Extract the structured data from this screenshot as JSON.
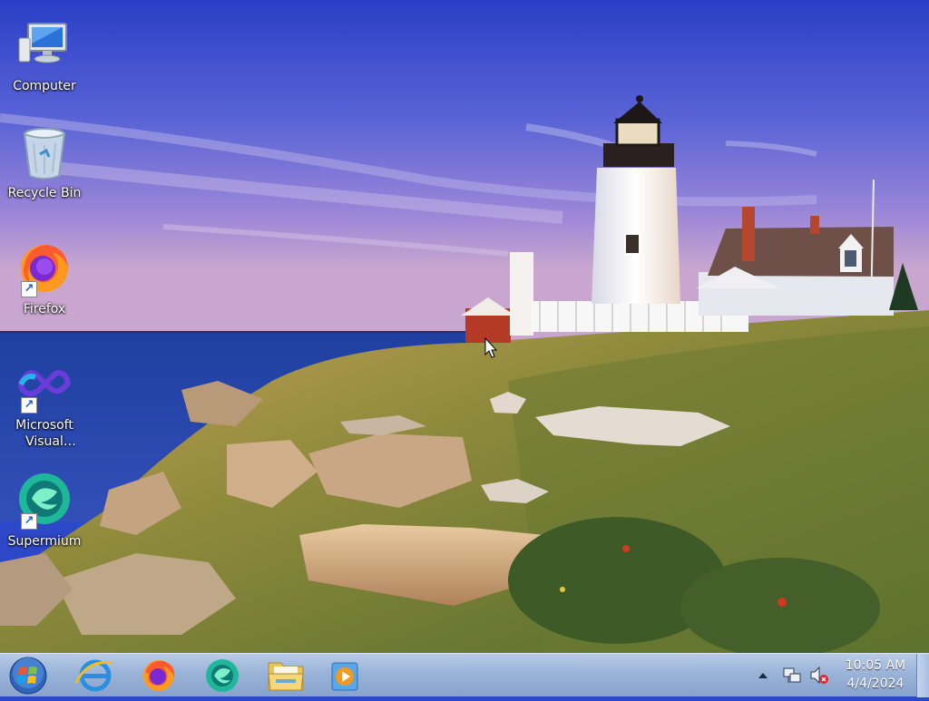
{
  "desktop": {
    "icons": [
      {
        "label": "Computer",
        "icon": "computer-icon"
      },
      {
        "label": "Recycle Bin",
        "icon": "recycle-bin-icon"
      },
      {
        "label": "Firefox",
        "icon": "firefox-icon"
      },
      {
        "label": "Microsoft Visual Studi...",
        "icon": "visual-studio-icon"
      },
      {
        "label": "Supermium",
        "icon": "supermium-icon"
      }
    ]
  },
  "taskbar": {
    "pinned": [
      "internet-explorer-icon",
      "firefox-icon",
      "supermium-icon",
      "file-explorer-icon",
      "media-player-icon"
    ],
    "tray": [
      "show-hidden-icons-icon",
      "network-icon",
      "volume-muted-icon"
    ],
    "clock": {
      "time": "10:05 AM",
      "date": "4/4/2024"
    }
  }
}
